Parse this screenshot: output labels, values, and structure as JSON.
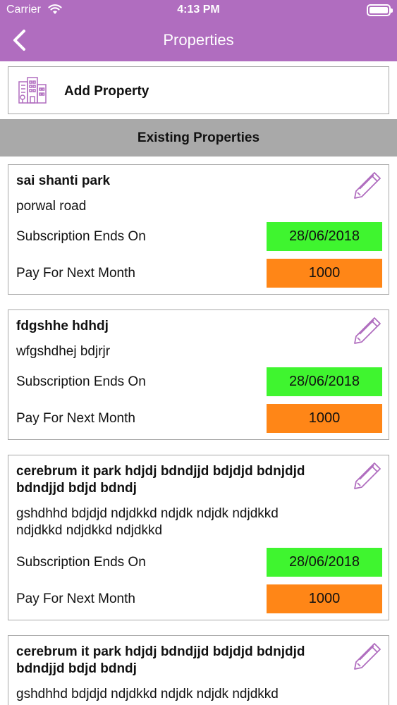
{
  "status_bar": {
    "carrier": "Carrier",
    "time": "4:13 PM"
  },
  "nav": {
    "title": "Properties",
    "back_icon": "chevron-left-icon"
  },
  "add_property": {
    "label": "Add Property",
    "icon": "building-icon"
  },
  "section": {
    "title": "Existing Properties"
  },
  "colors": {
    "accent": "#b06dbf",
    "subscription_bg": "#3ff52f",
    "payment_bg": "#ff8617",
    "section_bg": "#a9a9a9"
  },
  "properties": [
    {
      "name": "sai shanti park",
      "address": "porwal road",
      "subscription_label": "Subscription Ends On",
      "subscription_date": "28/06/2018",
      "pay_label": "Pay For Next Month",
      "pay_amount": "1000"
    },
    {
      "name": "fdgshhe hdhdj",
      "address": "wfgshdhej bdjrjr",
      "subscription_label": "Subscription Ends On",
      "subscription_date": "28/06/2018",
      "pay_label": "Pay For Next Month",
      "pay_amount": "1000"
    },
    {
      "name": "cerebrum it park hdjdj bdndjjd bdjdjd bdnjdjd bdndjjd bdjd bdndj",
      "address": "gshdhhd bdjdjd ndjdkkd ndjdk ndjdk ndjdkkd ndjdkkd ndjdkkd ndjdkkd",
      "subscription_label": "Subscription Ends On",
      "subscription_date": "28/06/2018",
      "pay_label": "Pay For Next Month",
      "pay_amount": "1000"
    },
    {
      "name": "cerebrum it park hdjdj bdndjjd bdjdjd bdnjdjd bdndjjd bdjd bdndj",
      "address": "gshdhhd bdjdjd ndjdkkd ndjdk ndjdk ndjdkkd"
    }
  ]
}
